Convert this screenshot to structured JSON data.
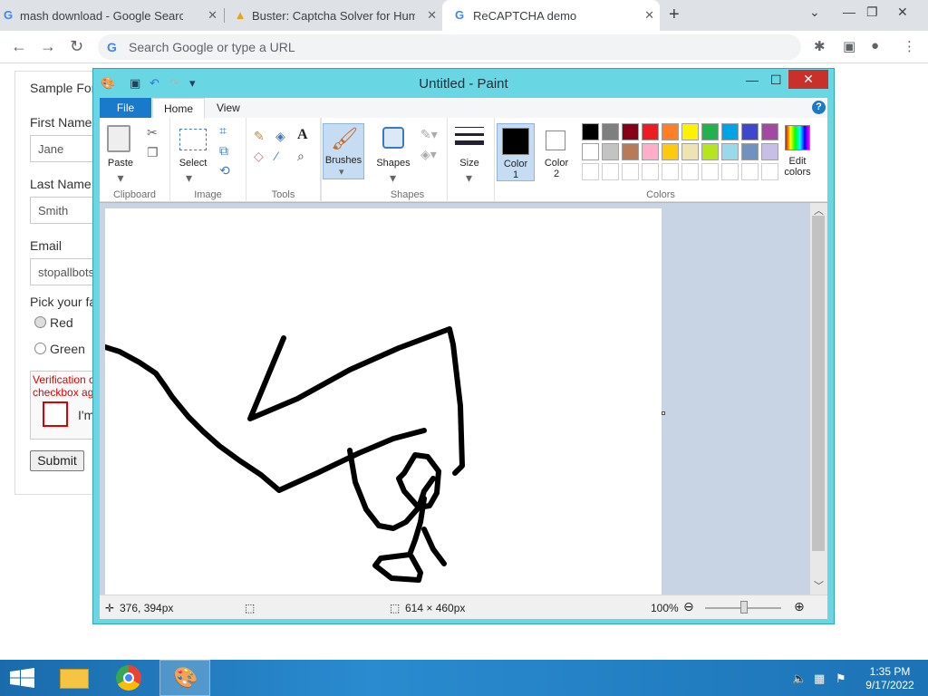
{
  "browser": {
    "tabs": [
      {
        "title": "mash download - Google Search",
        "favicon": "google-icon"
      },
      {
        "title": "Buster: Captcha Solver for Huma",
        "favicon": "buster-icon"
      },
      {
        "title": "ReCAPTCHA demo",
        "favicon": "google-icon"
      }
    ],
    "omnibox_placeholder": "Search Google or type a URL"
  },
  "form": {
    "title": "Sample For",
    "first_name_label": "First Name",
    "first_name_value": "Jane",
    "last_name_label": "Last Name",
    "last_name_value": "Smith",
    "email_label": "Email",
    "email_value": "stopallbots",
    "color_question": "Pick your fa",
    "radio_red": "Red",
    "radio_green": "Green",
    "verification_line1": "Verification c",
    "verification_line2": "checkbox ag",
    "captcha_text": "I'm",
    "submit_label": "Submit"
  },
  "paint": {
    "title": "Untitled - Paint",
    "tabs": {
      "file": "File",
      "home": "Home",
      "view": "View"
    },
    "groups": {
      "clipboard": "Clipboard",
      "image": "Image",
      "tools": "Tools",
      "shapes": "Shapes",
      "colors": "Colors"
    },
    "buttons": {
      "paste": "Paste",
      "select": "Select",
      "brushes": "Brushes",
      "shapes": "Shapes",
      "size": "Size",
      "color1_a": "Color",
      "color1_b": "1",
      "color2_a": "Color",
      "color2_b": "2",
      "edit_colors_a": "Edit",
      "edit_colors_b": "colors"
    },
    "color1": "#000000",
    "color2": "#ffffff",
    "palette_row1": [
      "#000000",
      "#7f7f7f",
      "#880015",
      "#ed1c24",
      "#ff7f27",
      "#fff200",
      "#22b14c",
      "#00a2e8",
      "#3f48cc",
      "#a349a4"
    ],
    "palette_row2": [
      "#ffffff",
      "#c3c3c3",
      "#b97a57",
      "#ffaec9",
      "#ffc90e",
      "#efe4b0",
      "#b5e61d",
      "#99d9ea",
      "#7092be",
      "#c8bfe7"
    ],
    "status": {
      "cursor": "376, 394px",
      "size": "614 × 460px",
      "zoom": "100%"
    }
  },
  "taskbar": {
    "time": "1:35 PM",
    "date": "9/17/2022"
  }
}
